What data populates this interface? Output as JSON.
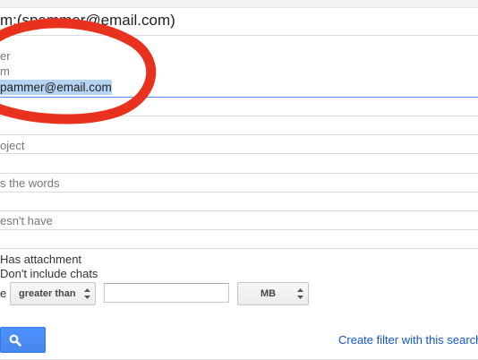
{
  "search_query": "m:(spammer@email.com)",
  "filter_form": {
    "section_label": "er",
    "from_label": "m",
    "from_value": "pammer@email.com",
    "subject_label": "oject",
    "has_words_label": "s the words",
    "doesnt_have_label": "esn't have",
    "has_attachment_label": "Has attachment",
    "dont_include_chats_label": "Don't include chats",
    "size_label": "e",
    "size_operator_value": "greater than",
    "size_value": "",
    "size_unit_value": "MB"
  },
  "actions": {
    "search_button_icon": "search-icon",
    "create_filter_link": "Create filter with this search"
  },
  "colors": {
    "accent_blue": "#4d90fe",
    "link_blue": "#1155cc",
    "annotation_red": "#e8321d",
    "selection_highlight": "#b5d4f3"
  }
}
